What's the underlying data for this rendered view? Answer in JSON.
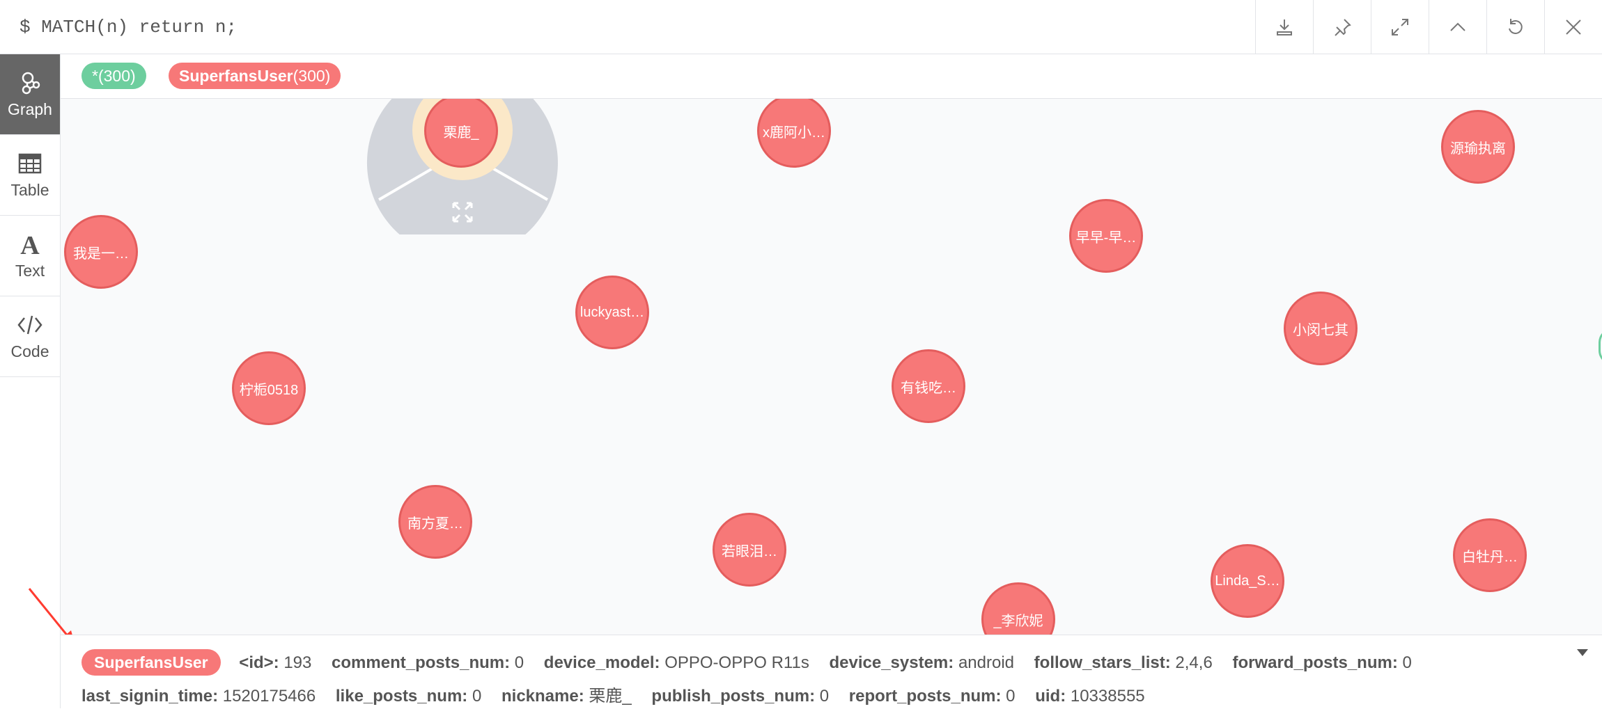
{
  "query": "$ MATCH(n) return n;",
  "toolbar": [
    {
      "name": "download-icon"
    },
    {
      "name": "pin-icon"
    },
    {
      "name": "expand-icon"
    },
    {
      "name": "collapse-icon"
    },
    {
      "name": "rerun-icon"
    },
    {
      "name": "close-icon"
    }
  ],
  "sidebar": {
    "items": [
      {
        "label": "Graph",
        "icon": "graph-icon",
        "active": true
      },
      {
        "label": "Table",
        "icon": "table-icon",
        "active": false
      },
      {
        "label": "Text",
        "icon": "text-icon",
        "active": false
      },
      {
        "label": "Code",
        "icon": "code-icon",
        "active": false
      }
    ]
  },
  "legend": {
    "all": {
      "label": "*(300)",
      "color": "#6dce9e"
    },
    "label_name": "SuperfansUser",
    "label_count": "(300)",
    "label_color": "#f77878"
  },
  "nodes": [
    {
      "label": "栗鹿_",
      "selected": true
    },
    {
      "label": "x鹿阿小…"
    },
    {
      "label": "源瑜执离"
    },
    {
      "label": "我是一…"
    },
    {
      "label": "早早-早…"
    },
    {
      "label": "luckyast…"
    },
    {
      "label": "小闵七其"
    },
    {
      "label": "柠栀0518"
    },
    {
      "label": "有钱吃…"
    },
    {
      "label": "南方夏…"
    },
    {
      "label": "若眼泪…"
    },
    {
      "label": "白牡丹…"
    },
    {
      "label": "Linda_S…"
    },
    {
      "label": "_李欣妮"
    }
  ],
  "details": {
    "badge": "SuperfansUser",
    "row1": [
      {
        "k": "<id>:",
        "v": "193"
      },
      {
        "k": "comment_posts_num:",
        "v": "0"
      },
      {
        "k": "device_model:",
        "v": "OPPO-OPPO R11s"
      },
      {
        "k": "device_system:",
        "v": "android"
      },
      {
        "k": "follow_stars_list:",
        "v": "2,4,6"
      },
      {
        "k": "forward_posts_num:",
        "v": "0"
      }
    ],
    "row2": [
      {
        "k": "last_signin_time:",
        "v": "1520175466"
      },
      {
        "k": "like_posts_num:",
        "v": "0"
      },
      {
        "k": "nickname:",
        "v": "栗鹿_"
      },
      {
        "k": "publish_posts_num:",
        "v": "0"
      },
      {
        "k": "report_posts_num:",
        "v": "0"
      },
      {
        "k": "uid:",
        "v": "10338555"
      }
    ]
  },
  "colors": {
    "node_fill": "#f77878",
    "node_border": "#e45d5d",
    "arrow": "#ff3b30"
  }
}
